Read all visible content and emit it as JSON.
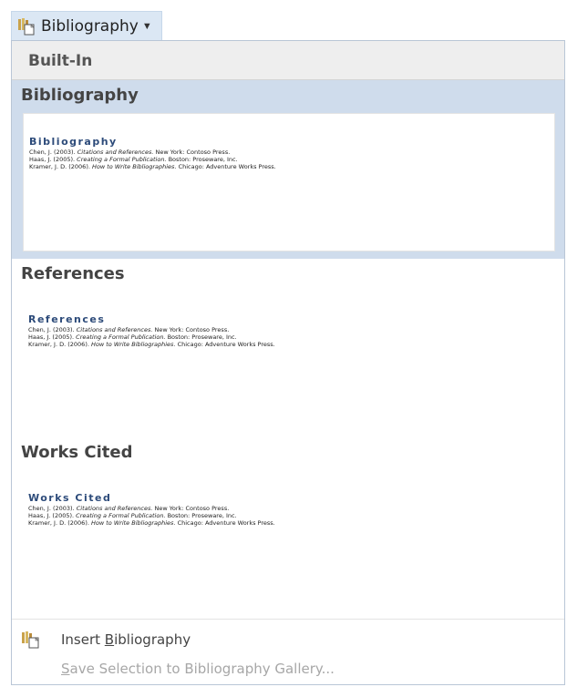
{
  "button": {
    "label": "Bibliography",
    "icon": "bibliography-icon"
  },
  "gallery": {
    "section_header": "Built-In",
    "items": [
      {
        "title": "Bibliography",
        "preview_heading": "Bibliography",
        "entries": [
          {
            "pre": "Chen, J. (2003). ",
            "italic": "Citations and References.",
            "post": " New York: Contoso Press."
          },
          {
            "pre": "Haas, J. (2005). ",
            "italic": "Creating a Formal Publication.",
            "post": " Boston: Proseware, Inc."
          },
          {
            "pre": "Kramer, J. D. (2006). ",
            "italic": "How to Write Bibliographies.",
            "post": " Chicago: Adventure Works Press."
          }
        ]
      },
      {
        "title": "References",
        "preview_heading": "References",
        "entries": [
          {
            "pre": "Chen, J. (2003). ",
            "italic": "Citations and References.",
            "post": " New York: Contoso Press."
          },
          {
            "pre": "Haas, J. (2005). ",
            "italic": "Creating a Formal Publication.",
            "post": " Boston: Proseware, Inc."
          },
          {
            "pre": "Kramer, J. D. (2006). ",
            "italic": "How to Write Bibliographies.",
            "post": " Chicago: Adventure Works Press."
          }
        ]
      },
      {
        "title": "Works Cited",
        "preview_heading": "Works Cited",
        "entries": [
          {
            "pre": "Chen, J. (2003). ",
            "italic": "Citations and References.",
            "post": " New York: Contoso Press."
          },
          {
            "pre": "Haas, J. (2005). ",
            "italic": "Creating a Formal Publication.",
            "post": " Boston: Proseware, Inc."
          },
          {
            "pre": "Kramer, J. D. (2006). ",
            "italic": "How to Write Bibliographies.",
            "post": " Chicago: Adventure Works Press."
          }
        ]
      }
    ]
  },
  "menu": {
    "insert": {
      "before": "Insert ",
      "accel": "B",
      "after": "ibliography",
      "icon": "bibliography-icon"
    },
    "save": {
      "accel": "S",
      "after": "ave Selection to Bibliography Gallery...",
      "disabled": true
    }
  },
  "colors": {
    "selected_bg": "#cfdcec",
    "button_bg": "#dbe7f4",
    "heading_blue": "#2d4b7a"
  }
}
